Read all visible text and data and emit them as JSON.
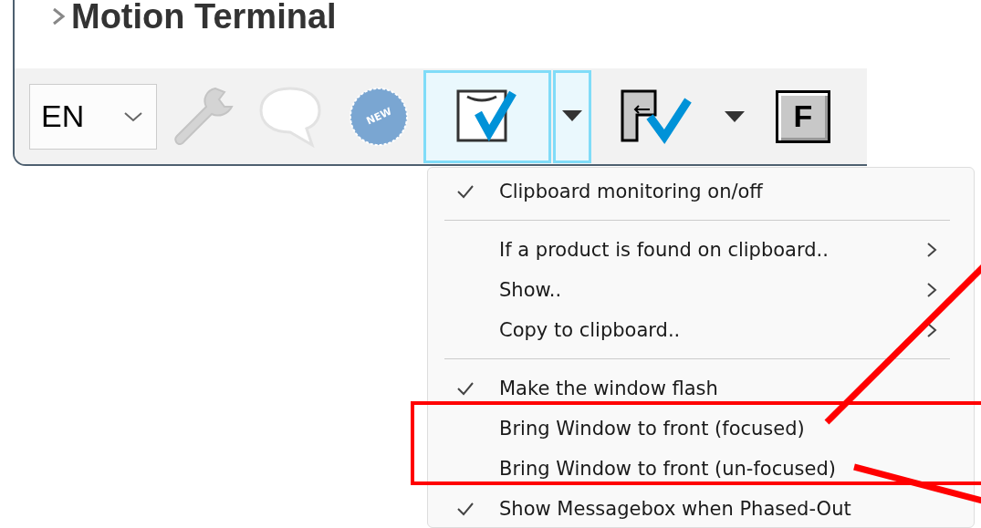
{
  "window": {
    "title": "Motion Terminal"
  },
  "toolbar": {
    "language": {
      "value": "EN"
    },
    "new_badge": {
      "label": "NEW"
    },
    "clipboard_button": {
      "active": true
    },
    "f_button": {
      "label": "F"
    }
  },
  "menu": {
    "items": [
      {
        "kind": "item",
        "label": "Clipboard monitoring on/off",
        "checked": true,
        "submenu": false
      },
      {
        "kind": "separator"
      },
      {
        "kind": "item",
        "label": "If a product is found on clipboard..",
        "checked": false,
        "submenu": true
      },
      {
        "kind": "item",
        "label": "Show..",
        "checked": false,
        "submenu": true
      },
      {
        "kind": "item",
        "label": "Copy to clipboard..",
        "checked": false,
        "submenu": true
      },
      {
        "kind": "separator"
      },
      {
        "kind": "item",
        "label": "Make the window flash",
        "checked": true,
        "submenu": false
      },
      {
        "kind": "item",
        "label": "Bring Window to front (focused)",
        "checked": false,
        "submenu": false
      },
      {
        "kind": "item",
        "label": "Bring Window to front (un-focused)",
        "checked": false,
        "submenu": false
      },
      {
        "kind": "item",
        "label": "Show Messagebox when Phased-Out",
        "checked": true,
        "submenu": false
      }
    ]
  }
}
